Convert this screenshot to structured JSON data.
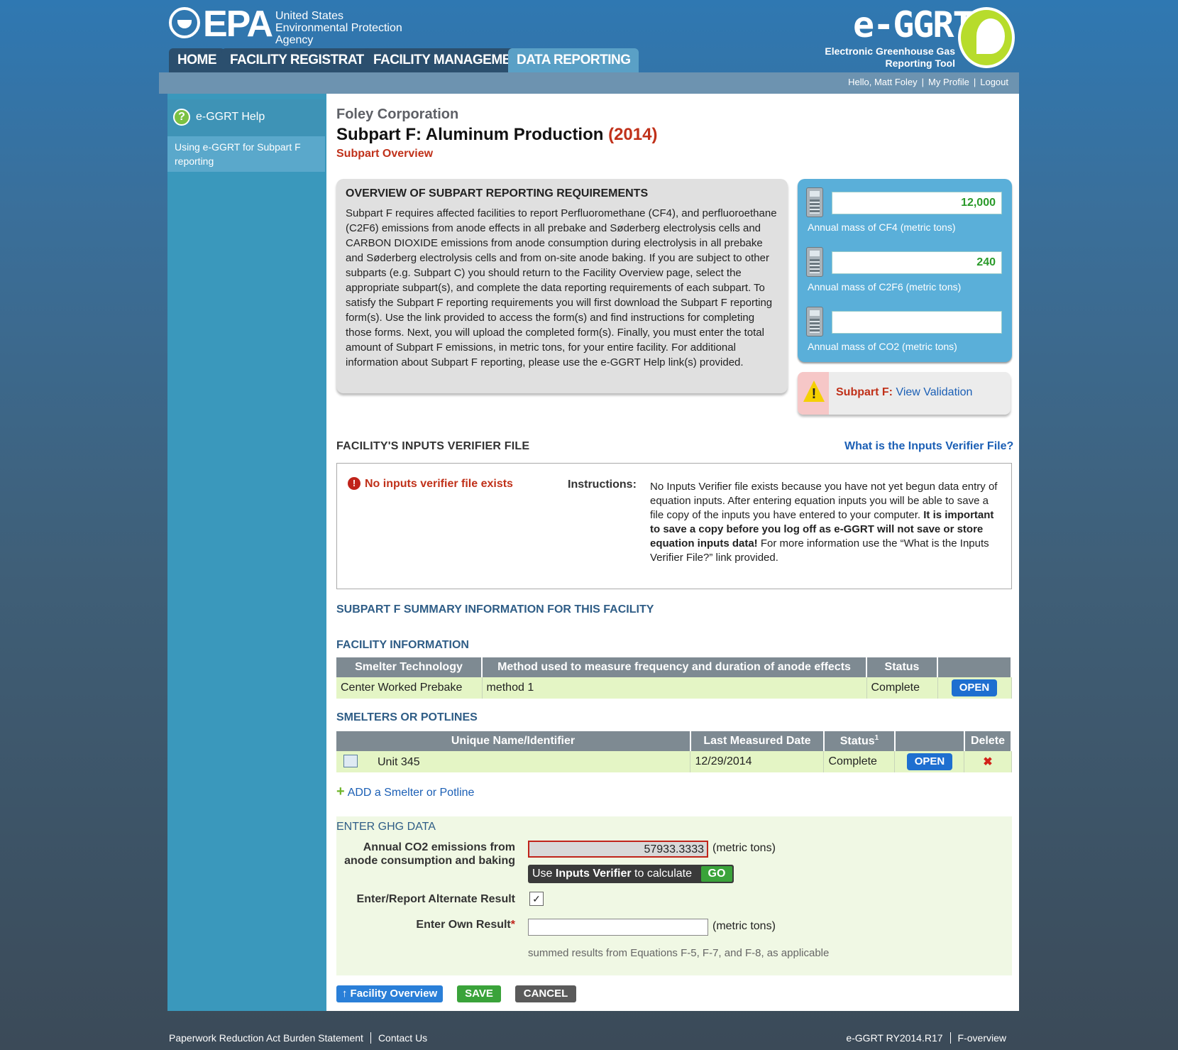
{
  "header": {
    "epa_letters": "EPA",
    "epa_name": "United States\nEnvironmental Protection\nAgency",
    "tool_name": "e-GGRT",
    "tool_sub": "Electronic Greenhouse Gas\nReporting Tool"
  },
  "tabs": [
    "HOME",
    "FACILITY REGISTRATION",
    "FACILITY MANAGEMENT",
    "DATA REPORTING"
  ],
  "active_tab": "DATA REPORTING",
  "user": {
    "hello": "Hello, Matt Foley",
    "profile": "My Profile",
    "logout": "Logout"
  },
  "sidebar": {
    "help": "e-GGRT Help",
    "item": "Using e-GGRT for Subpart F reporting"
  },
  "page": {
    "org": "Foley Corporation",
    "title": "Subpart F: Aluminum Production",
    "year": "(2014)",
    "subtitle": "Subpart Overview"
  },
  "overview": {
    "title": "OVERVIEW OF SUBPART REPORTING REQUIREMENTS",
    "text": "Subpart F requires affected facilities to report Perfluoromethane (CF4), and perfluoroethane (C2F6) emissions from anode effects in all prebake and Søderberg electrolysis cells and CARBON DIOXIDE emissions from anode consumption during electrolysis in all prebake and Søderberg electrolysis cells and from on-site anode baking. If you are subject to other subparts (e.g. Subpart C) you should return to the Facility Overview page, select the appropriate subpart(s), and complete the data reporting requirements of each subpart. To satisfy the Subpart F reporting requirements you will first download the Subpart F reporting form(s). Use the link provided to access the form(s) and find instructions for completing those forms. Next, you will upload the completed form(s). Finally, you must enter the total amount of Subpart F emissions, in metric tons, for your entire facility. For additional information about Subpart F reporting, please use the e-GGRT Help link(s) provided."
  },
  "calc": [
    {
      "value": "12,000",
      "label": "Annual mass of CF4 (metric tons)"
    },
    {
      "value": "240",
      "label": "Annual mass of C2F6 (metric tons)"
    },
    {
      "value": "",
      "label": "Annual mass of CO2 (metric tons)"
    }
  ],
  "validation": {
    "subpart": "Subpart F:",
    "link": "View Validation"
  },
  "verifier": {
    "title": "FACILITY'S INPUTS VERIFIER FILE",
    "help_link": "What is the Inputs Verifier File?",
    "status": "No inputs verifier file exists",
    "instructions_label": "Instructions:",
    "instr_a": "No Inputs Verifier file exists because you have not yet begun data entry of equation inputs.  After entering equation inputs you will be able to save a file copy of the inputs you have entered to your computer. ",
    "instr_b": "It is important to save a copy before you log off as e-GGRT will not save or store equation inputs data!",
    "instr_c": " For more information use the “What is the Inputs Verifier File?” link provided."
  },
  "summary_title": "SUBPART F SUMMARY INFORMATION FOR THIS FACILITY",
  "facility_info": {
    "title": "FACILITY INFORMATION",
    "headers": [
      "Smelter Technology",
      "Method used to measure frequency and duration of anode effects",
      "Status",
      ""
    ],
    "row": {
      "tech": "Center Worked Prebake",
      "method": "method 1",
      "status": "Complete",
      "action": "OPEN"
    }
  },
  "smelters": {
    "title": "SMELTERS OR POTLINES",
    "headers": [
      "Unique Name/Identifier",
      "Last Measured Date",
      "Status",
      "",
      "Delete"
    ],
    "status_sup": "1",
    "row": {
      "name": "Unit 345",
      "date": "12/29/2014",
      "status": "Complete",
      "action": "OPEN",
      "delete": "✖"
    },
    "add": "ADD a Smelter or Potline"
  },
  "ghg": {
    "title": "ENTER GHG DATA",
    "co2_label": "Annual CO2 emissions from anode consumption and baking",
    "co2_value": "57933.3333",
    "unit": "(metric tons)",
    "verifier_text_a": "Use ",
    "verifier_text_b": "Inputs Verifier",
    "verifier_text_c": " to calculate",
    "go": "GO",
    "alt_label": "Enter/Report Alternate Result",
    "alt_checked": "✓",
    "own_label": "Enter Own Result",
    "own_req": "*",
    "own_value": "",
    "note": "summed results from Equations F-5, F-7, and F-8, as applicable"
  },
  "buttons": {
    "facility_overview": "Facility Overview",
    "save": "SAVE",
    "cancel": "CANCEL"
  },
  "footer": {
    "paperwork": "Paperwork Reduction Act Burden Statement",
    "contact": "Contact Us",
    "version": "e-GGRT RY2014.R17",
    "page_id": "F-overview"
  }
}
